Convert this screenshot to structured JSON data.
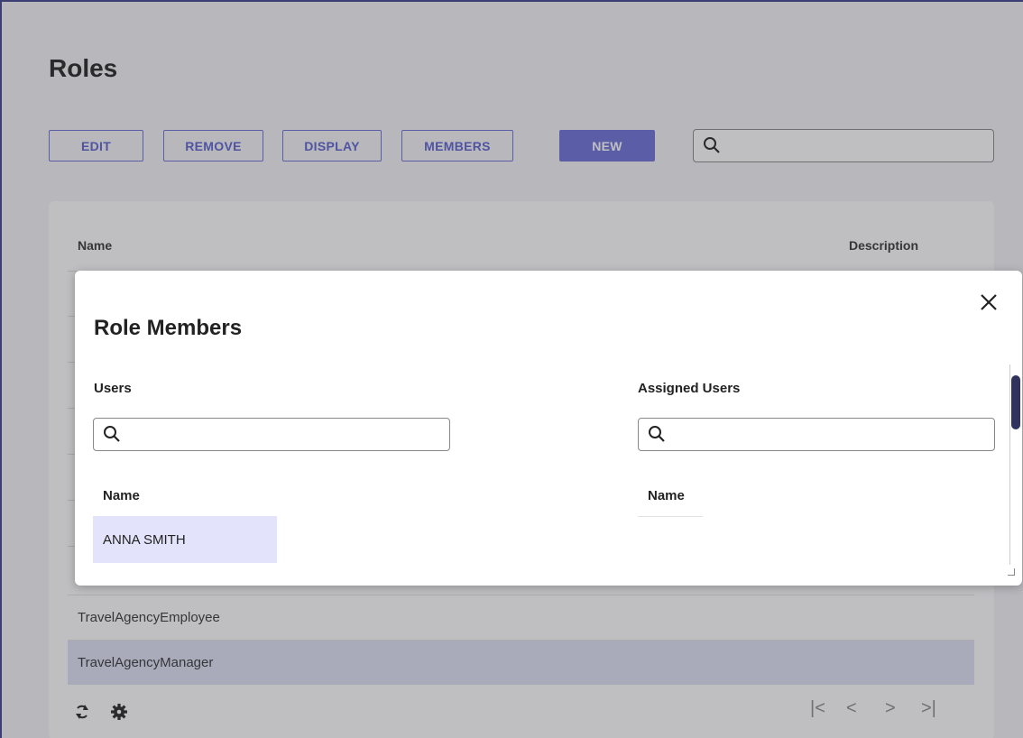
{
  "page": {
    "title": "Roles"
  },
  "toolbar": {
    "edit_label": "EDIT",
    "remove_label": "REMOVE",
    "display_label": "DISPLAY",
    "members_label": "MEMBERS",
    "new_label": "NEW",
    "search_value": ""
  },
  "grid": {
    "columns": {
      "name": "Name",
      "description": "Description"
    },
    "rows": [
      {
        "name": "TravelAgencyEmployee",
        "description": ""
      },
      {
        "name": "TravelAgencyManager",
        "description": ""
      }
    ]
  },
  "modal": {
    "title": "Role Members",
    "users": {
      "label": "Users",
      "search_value": "",
      "column": "Name",
      "items": [
        "ANNA SMITH"
      ]
    },
    "assigned": {
      "label": "Assigned Users",
      "search_value": "",
      "column": "Name"
    }
  },
  "colors": {
    "accent": "#6b6fd6",
    "selected_row": "#dfe1f5",
    "scrollbar": "#2f335e"
  }
}
